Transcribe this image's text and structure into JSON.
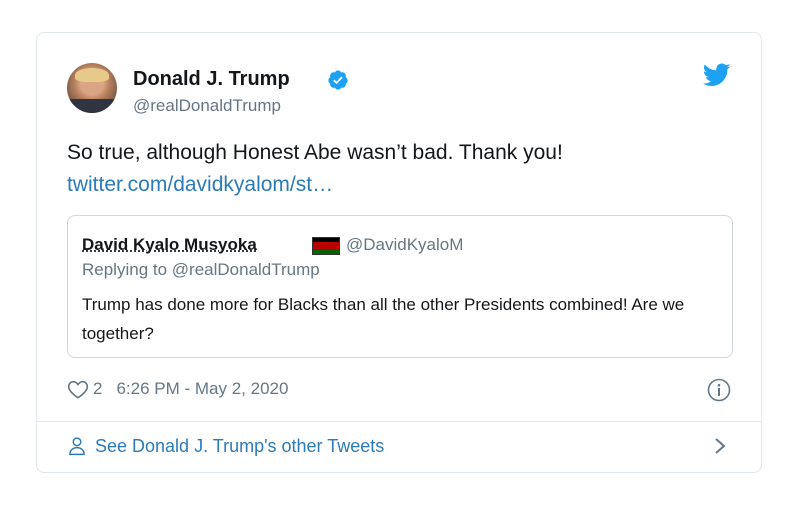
{
  "tweet": {
    "author_name": "Donald J. Trump",
    "author_handle": "@realDonaldTrump",
    "text": "So true, although Honest Abe wasn’t bad. Thank you!",
    "link": "twitter.com/davidkyalom/st…",
    "likes": "2",
    "timestamp": "6:26 PM - May 2, 2020"
  },
  "quoted": {
    "name": "David Kyalo Musyoka",
    "handle": "@DavidKyaloM",
    "replying_to": "Replying to @realDonaldTrump",
    "text": "Trump has done more for Blacks than all the other Presidents combined! Are we together?"
  },
  "footer": {
    "label": "See Donald J. Trump's other Tweets"
  },
  "icons": {
    "verified": "verified-badge-icon",
    "bird": "twitter-bird-icon",
    "heart": "heart-icon",
    "info": "info-icon",
    "person": "person-icon",
    "chevron": "chevron-right-icon",
    "flag": "kenya-flag-icon"
  },
  "colors": {
    "link": "#2b7bb9",
    "verified": "#1da1f2",
    "muted": "#657786",
    "border": "#e1e8ed"
  }
}
